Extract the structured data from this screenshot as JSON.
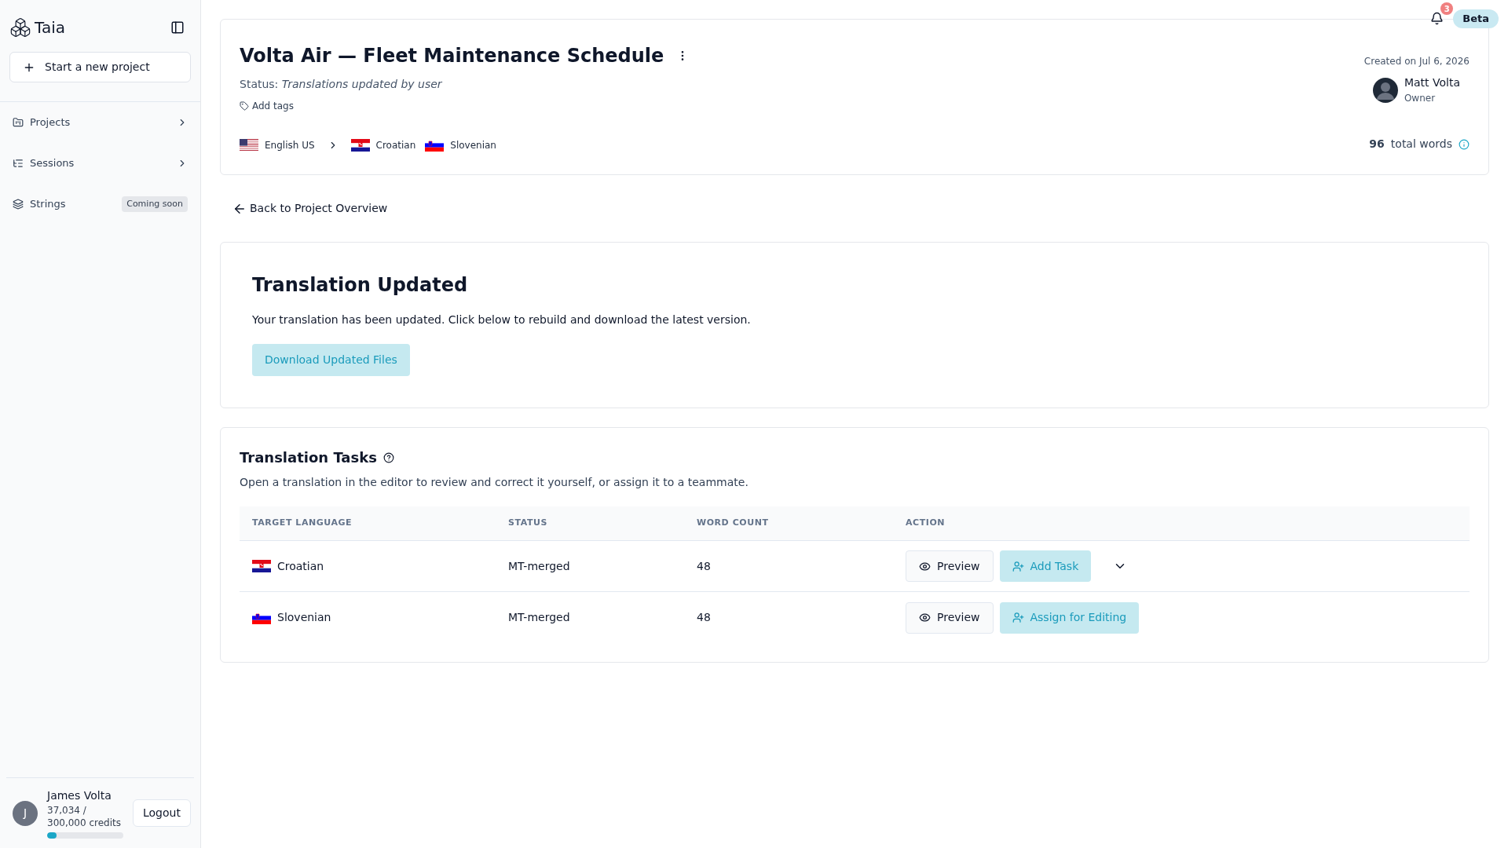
{
  "sidebar": {
    "logo": "Taia",
    "new_project": "Start a new project",
    "items": [
      {
        "kind": "projects",
        "label": "Projects",
        "chevron": true
      },
      {
        "kind": "sessions",
        "label": "Sessions",
        "chevron": true
      },
      {
        "kind": "strings",
        "label": "Strings",
        "chevron": false,
        "badge": "Coming soon"
      }
    ],
    "user": {
      "initial": "J",
      "name": "James Volta",
      "credits_line1": "37,034 /",
      "credits_line2": "300,000 credits",
      "level": 0.123,
      "logout": "Logout"
    }
  },
  "topbar": {
    "notifications": "3",
    "beta": "Beta"
  },
  "project": {
    "title": "Volta Air — Fleet Maintenance Schedule",
    "status_label": "Status:",
    "status": "Translations updated by user",
    "add_tags": "Add tags",
    "created": "Created on Jul 6, 2026",
    "owner_name": "Matt Volta",
    "owner_role": "Owner",
    "source": {
      "kind": "us",
      "name": "English US"
    },
    "targets": [
      {
        "kind": "hr",
        "name": "Croatian"
      },
      {
        "kind": "si",
        "name": "Slovenian"
      }
    ],
    "word_count": "96",
    "word_label": "total words"
  },
  "back_link": "Back to Project Overview",
  "update_card": {
    "title": "Translation Updated",
    "text": "Your translation has been updated. Click below to rebuild and download the latest version.",
    "button": "Download Updated Files"
  },
  "tasks": {
    "title": "Translation Tasks",
    "subtitle": "Open a translation in the editor to review and correct it yourself, or assign it to a teammate.",
    "columns": [
      "TARGET LANGUAGE",
      "STATUS",
      "WORD COUNT",
      "ACTION"
    ],
    "rows": [
      {
        "kind": "hr",
        "language": "Croatian",
        "status": "MT-merged",
        "words": "48",
        "preview": "Preview",
        "action": "Add Task",
        "has_menu": true
      },
      {
        "kind": "si",
        "language": "Slovenian",
        "status": "MT-merged",
        "words": "48",
        "preview": "Preview",
        "action": "Assign for Editing",
        "has_menu": false
      }
    ]
  }
}
